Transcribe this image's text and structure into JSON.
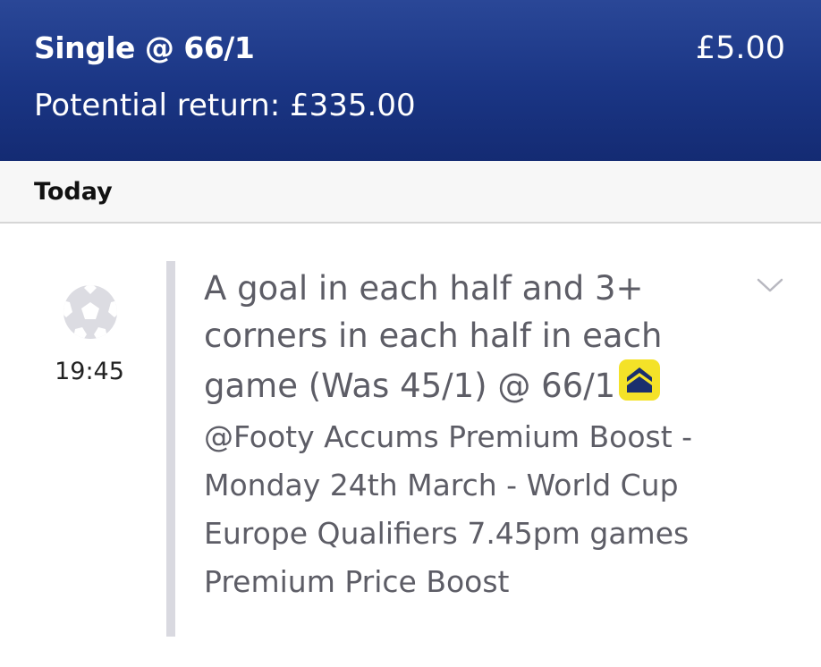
{
  "header": {
    "bet_type": "Single @ 66/1",
    "stake": "£5.00",
    "potential_return": "Potential return: £335.00",
    "colors": {
      "background": "#1a3584",
      "text": "#ffffff"
    }
  },
  "day_bar": {
    "label": "Today"
  },
  "selection": {
    "sport_icon": "football-icon",
    "kickoff_time": "19:45",
    "market_text": "A goal in each half and 3+ corners in each half in each game (Was 45/1) @ 66/1",
    "boost_icon": "price-boost-icon",
    "boost_color": "#f4e228",
    "description": "@Footy Accums Premium Boost - Monday 24th March - World Cup Europe Qualifiers 7.45pm games Premium Price Boost",
    "expand_icon": "chevron-down-icon"
  }
}
